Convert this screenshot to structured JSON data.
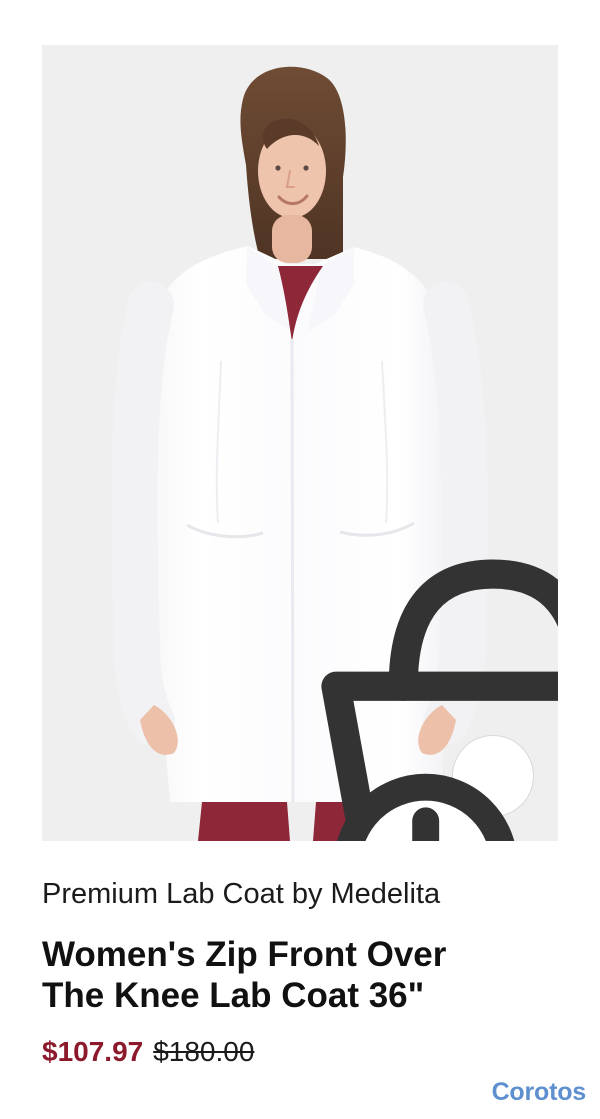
{
  "product": {
    "brand_line": "Premium Lab Coat by Medelita",
    "title_line_1": "Women's Zip Front Over",
    "title_line_2": "The Knee Lab Coat 36\"",
    "sale_price": "$107.97",
    "original_price": "$180.00"
  },
  "watermark": {
    "text": "Corotos"
  },
  "colors": {
    "image_background": "#efefef",
    "sale_price": "#8c1a2c",
    "watermark": "#5e8fcf",
    "scrub_color": "#8e2738"
  },
  "icons": {
    "bag_add": "bag-add-icon"
  }
}
